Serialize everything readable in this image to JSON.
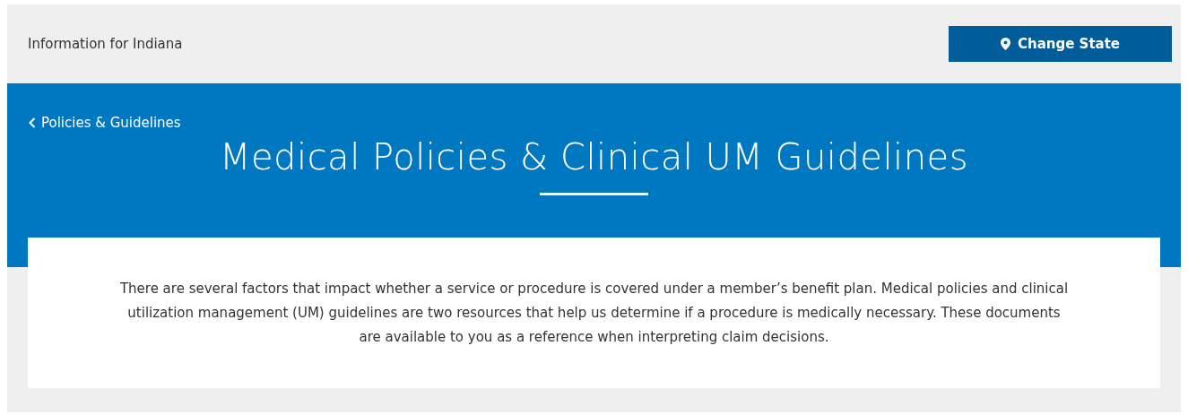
{
  "top_bar": {
    "info": "Information for Indiana",
    "button": "Change State"
  },
  "hero": {
    "back_link": "Policies & Guidelines",
    "title": "Medical Policies & Clinical UM Guidelines"
  },
  "intro": "There are several factors that impact whether a service or procedure is covered under a member’s benefit plan. Medical policies and clinical utilization management (UM) guidelines are two resources that help us determine if a procedure is medically necessary. These documents are available to you as a reference when interpreting claim decisions."
}
